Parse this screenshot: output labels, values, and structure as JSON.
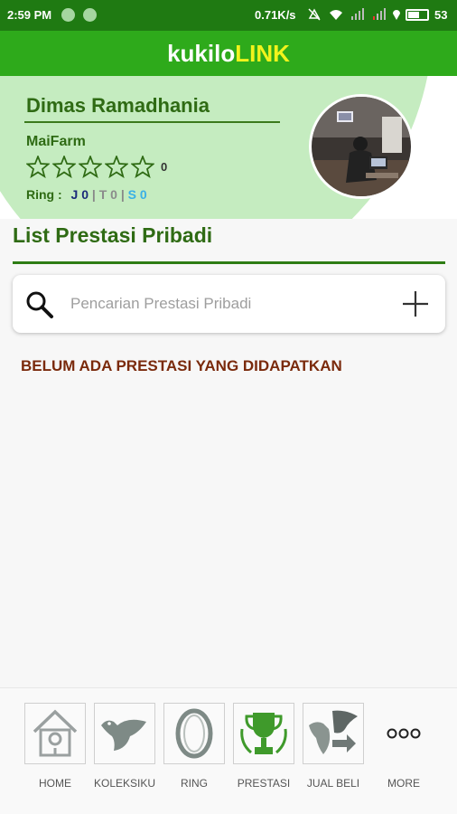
{
  "status_bar": {
    "time": "2:59 PM",
    "speed": "0.71K/s",
    "battery_level": "53",
    "bar_color": "#1f7a12"
  },
  "app_bar": {
    "title_part1": "kukilo",
    "title_part2": "LINK",
    "bg_color": "#2eaa1b",
    "accent_color": "#f1f31c"
  },
  "profile": {
    "name": "Dimas Ramadhania",
    "farm": "MaiFarm",
    "stars_filled": 0,
    "stars_total": 5,
    "rating_count": "0",
    "ring_label": "Ring :",
    "ring_j": "J 0",
    "ring_t": "T 0",
    "ring_s": "S 0",
    "ring_sep": "|",
    "avatar_icon": "user-photo"
  },
  "section": {
    "title": "List Prestasi Pribadi"
  },
  "search": {
    "placeholder": "Pencarian Prestasi Pribadi",
    "value": "",
    "search_icon": "search-icon",
    "add_icon": "plus-icon"
  },
  "empty_message": "BELUM ADA PRESTASI YANG DIDAPATKAN",
  "bottom_nav": {
    "items": [
      {
        "label": "HOME",
        "icon": "birdhouse-icon"
      },
      {
        "label": "KOLEKSIKU",
        "icon": "bird-icon"
      },
      {
        "label": "RING",
        "icon": "ring-icon"
      },
      {
        "label": "PRESTASI",
        "icon": "trophy-icon"
      },
      {
        "label": "JUAL BELI",
        "icon": "trade-bird-icon"
      },
      {
        "label": "MORE",
        "icon": "more-dots-icon"
      }
    ]
  }
}
